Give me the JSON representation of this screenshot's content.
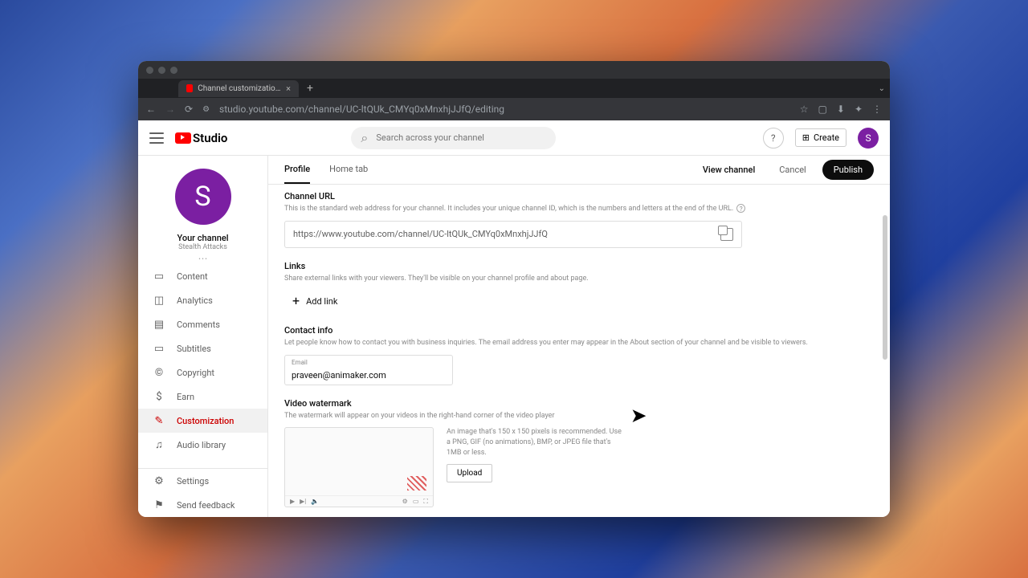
{
  "browser": {
    "tab_title": "Channel customization - You",
    "url": "studio.youtube.com/channel/UC-ltQUk_CMYq0xMnxhjJJfQ/editing"
  },
  "header": {
    "brand": "Studio",
    "search_placeholder": "Search across your channel",
    "create_label": "Create",
    "avatar_letter": "S"
  },
  "sidebar": {
    "avatar_letter": "S",
    "your_channel": "Your channel",
    "channel_name": "Stealth Attacks",
    "items": [
      {
        "label": "Content",
        "icon": "▭"
      },
      {
        "label": "Analytics",
        "icon": "◫"
      },
      {
        "label": "Comments",
        "icon": "▤"
      },
      {
        "label": "Subtitles",
        "icon": "▭"
      },
      {
        "label": "Copyright",
        "icon": "©"
      },
      {
        "label": "Earn",
        "icon": "$"
      },
      {
        "label": "Customization",
        "icon": "✎",
        "active": true
      },
      {
        "label": "Audio library",
        "icon": "♫"
      }
    ],
    "bottom": [
      {
        "label": "Settings",
        "icon": "⚙"
      },
      {
        "label": "Send feedback",
        "icon": "⚑"
      }
    ]
  },
  "tabs": {
    "profile": "Profile",
    "home": "Home tab"
  },
  "actions": {
    "view": "View channel",
    "cancel": "Cancel",
    "publish": "Publish"
  },
  "sections": {
    "channel_url": {
      "title": "Channel URL",
      "desc": "This is the standard web address for your channel. It includes your unique channel ID, which is the numbers and letters at the end of the URL.",
      "value": "https://www.youtube.com/channel/UC-ltQUk_CMYq0xMnxhjJJfQ"
    },
    "links": {
      "title": "Links",
      "desc": "Share external links with your viewers. They'll be visible on your channel profile and about page.",
      "add": "Add link"
    },
    "contact": {
      "title": "Contact info",
      "desc": "Let people know how to contact you with business inquiries. The email address you enter may appear in the About section of your channel and be visible to viewers.",
      "email_label": "Email",
      "email_value": "praveen@animaker.com"
    },
    "watermark": {
      "title": "Video watermark",
      "desc": "The watermark will appear on your videos in the right-hand corner of the video player",
      "info": "An image that's 150 x 150 pixels is recommended. Use a PNG, GIF (no animations), BMP, or JPEG file that's 1MB or less.",
      "upload": "Upload"
    }
  }
}
